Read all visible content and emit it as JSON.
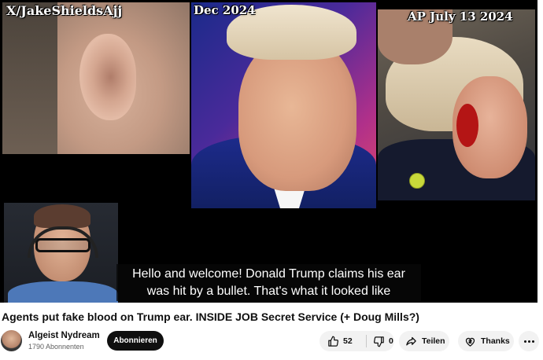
{
  "video": {
    "overlay_labels": {
      "credit": "X/JakeShieldsAjj",
      "date_dec": "Dec 2024",
      "date_ap": "AP July 13 2024"
    },
    "caption_lines": [
      "Hello and welcome! Donald Trump claims his ear",
      "was hit by a bullet. That's what it looked like"
    ]
  },
  "title": "Agents put fake blood on Trump ear. INSIDE JOB Secret Service (+ Doug Mills?)",
  "channel": {
    "name": "Algeist Nydream",
    "subscribers": "1790 Abonnenten",
    "subscribe_label": "Abonnieren"
  },
  "actions": {
    "likes": "52",
    "dislikes": "0",
    "share_label": "Teilen",
    "thanks_label": "Thanks",
    "icons": [
      "thumbs-up-icon",
      "thumbs-down-icon",
      "share-icon",
      "thanks-icon",
      "more-icon"
    ]
  }
}
